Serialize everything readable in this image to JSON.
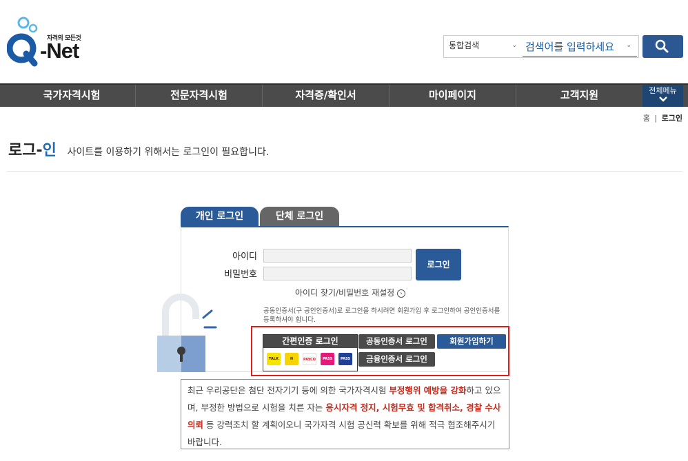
{
  "header": {
    "logo_tagline": "자격의 모든것",
    "logo_text": "-Net",
    "search_scope": "통합검색",
    "search_placeholder": "검색어를 입력하세요"
  },
  "nav": {
    "items": [
      {
        "label": "국가자격시험"
      },
      {
        "label": "전문자격시험"
      },
      {
        "label": "자격증/확인서"
      },
      {
        "label": "마이페이지"
      },
      {
        "label": "고객지원"
      }
    ],
    "all_menu": "전체메뉴"
  },
  "breadcrumb": {
    "home": "홈",
    "sep": "|",
    "current": "로그인"
  },
  "page": {
    "title_a": "로그",
    "title_dash": "-",
    "title_b": "인",
    "subtitle": "사이트를 이용하기 위해서는 로그인이 필요합니다."
  },
  "tabs": [
    {
      "label": "개인 로그인"
    },
    {
      "label": "단체 로그인"
    }
  ],
  "form": {
    "id_label": "아이디",
    "pw_label": "비밀번호",
    "login_button": "로그인",
    "find_link": "아이디 찾기/비밀번호 재설정",
    "notice": "공동인증서(구 공인인증서)로 로그인을 하시려면 회원가입 후 로그인하여 공인인증서를 등록하셔야 합니다."
  },
  "auth": {
    "easy_login": "간편인증 로그인",
    "joint_cert_login": "공동인증서 로그인",
    "signup": "회원가입하기",
    "finance_cert_login": "금융인증서 로그인",
    "providers": [
      {
        "name": "kakao-icon",
        "label": "TALK",
        "color": "#f7e200"
      },
      {
        "name": "naver-icon",
        "label": "N",
        "color": "#f7d400"
      },
      {
        "name": "payco-icon",
        "label": "PAYCO",
        "color": "#ffffff"
      },
      {
        "name": "pass-icon",
        "label": "PASS",
        "color": "#e6197b"
      },
      {
        "name": "pass-blue-icon",
        "label": "PASS",
        "color": "#1f3f99"
      }
    ]
  },
  "notice": {
    "t1": "최근 우리공단은 첨단 전자기기 등에 의한 국가자격시험 ",
    "r1": "부정행위 예방을 강화",
    "t2": "하고 있으며, 부정한 방법으로 시험을 치른 자는 ",
    "r2": "응시자격 정지, 시험무효 및 합격취소, 경찰 수사의뢰",
    "t3": " 등 강력조치 할 계획이오니 국가자격 시험 공신력 확보를 위해 적극 협조해주시기 바랍니다."
  },
  "colors": {
    "brand_blue": "#2a5b98",
    "nav_bg": "#4b4b4b",
    "alert_red": "#e31b1b"
  }
}
